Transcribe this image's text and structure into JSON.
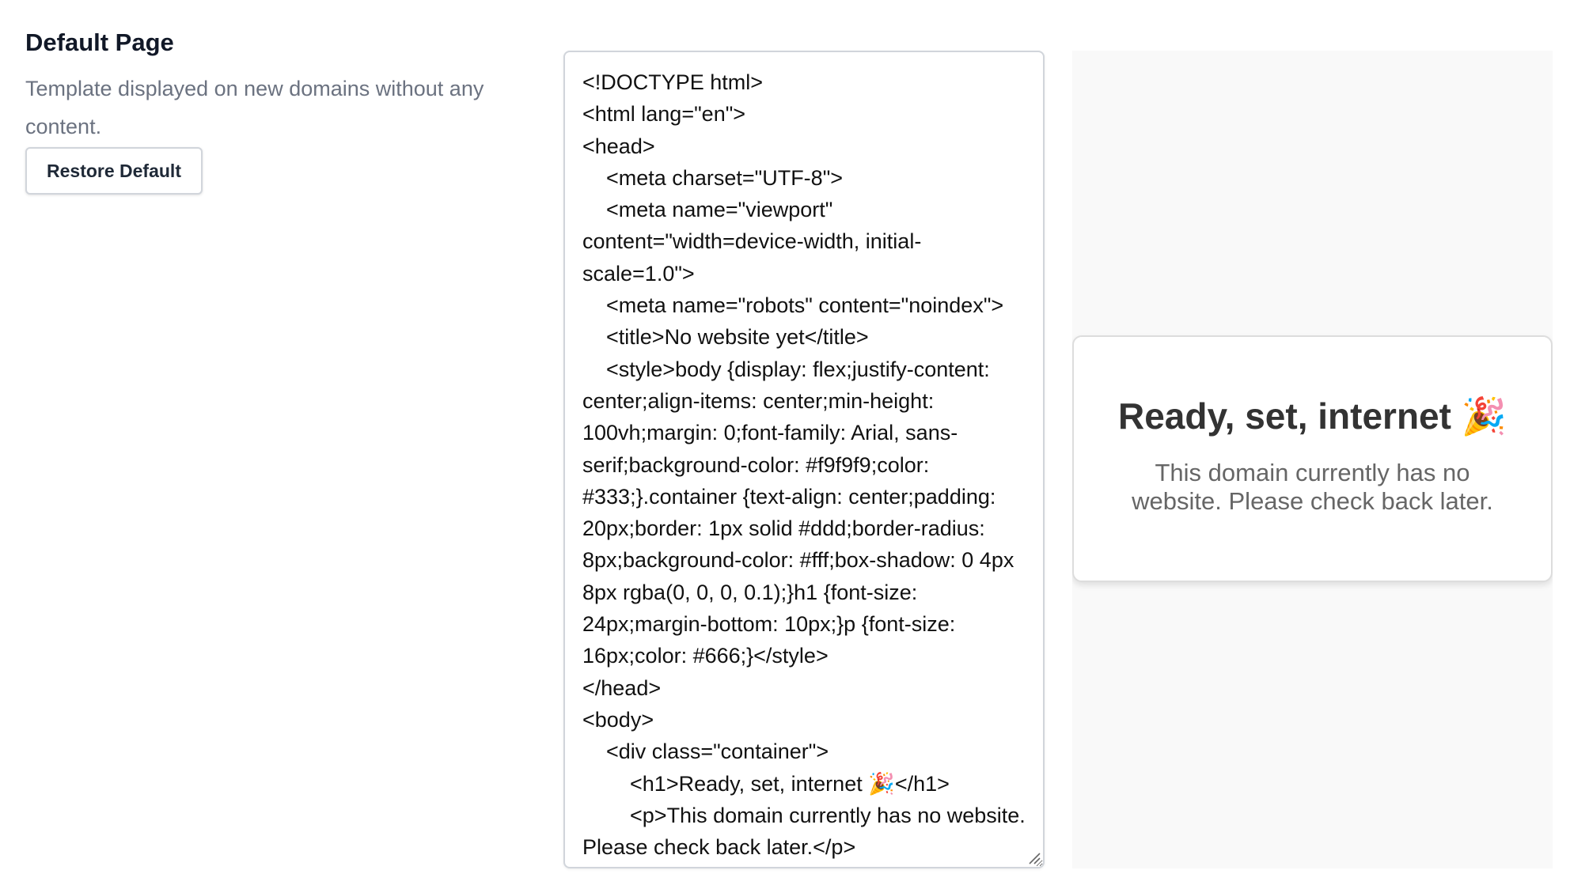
{
  "settings": {
    "title": "Default Page",
    "description": "Template displayed on new domains without any content.",
    "restore_label": "Restore Default"
  },
  "editor": {
    "code": "<!DOCTYPE html>\n<html lang=\"en\">\n<head>\n    <meta charset=\"UTF-8\">\n    <meta name=\"viewport\" content=\"width=device-width, initial-scale=1.0\">\n    <meta name=\"robots\" content=\"noindex\">\n    <title>No website yet</title>\n    <style>body {display: flex;justify-content: center;align-items: center;min-height: 100vh;margin: 0;font-family: Arial, sans-serif;background-color: #f9f9f9;color: #333;}.container {text-align: center;padding: 20px;border: 1px solid #ddd;border-radius: 8px;background-color: #fff;box-shadow: 0 4px 8px rgba(0, 0, 0, 0.1);}h1 {font-size: 24px;margin-bottom: 10px;}p {font-size: 16px;color: #666;}</style>\n</head>\n<body>\n    <div class=\"container\">\n        <h1>Ready, set, internet 🎉</h1>\n        <p>This domain currently has no website. Please check back later.</p>\n    </div>\n</body>\n</html>"
  },
  "preview": {
    "heading": "Ready, set, internet 🎉",
    "text": "This domain currently has no website. Please check back later.",
    "background": "#f9f9f9",
    "card_background": "#ffffff",
    "heading_color": "#333333",
    "text_color": "#666666"
  }
}
